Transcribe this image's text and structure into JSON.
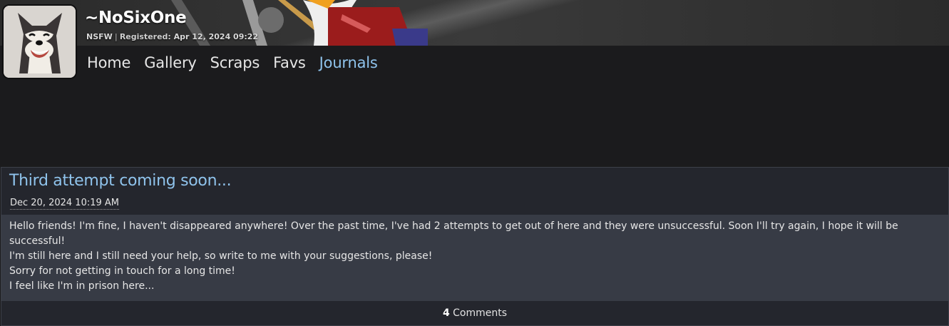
{
  "profile": {
    "username": "~NoSixOne",
    "rating": "NSFW",
    "separator": "|",
    "registered_label": "Registered:",
    "registered_date": "Apr 12, 2024 09:22"
  },
  "nav": {
    "items": [
      "Home",
      "Gallery",
      "Scraps",
      "Favs",
      "Journals"
    ],
    "active": "Journals"
  },
  "journal": {
    "title": "Third attempt coming soon...",
    "date": "Dec 20, 2024 10:19 AM",
    "body": [
      "Hello friends! I'm fine, I haven't disappeared anywhere! Over the past time, I've had 2 attempts to get out of here and they were unsuccessful. Soon I'll try again, I hope it will be successful!",
      "I'm still here and I still need your help, so write to me with your suggestions, please!",
      "Sorry for not getting in touch for a long time!",
      "I feel like I'm in prison here..."
    ],
    "comment_count": "4",
    "comment_label": "Comments"
  },
  "colors": {
    "accent": "#8fc3ec",
    "page_bg": "#1b1b1d",
    "body_bg": "#373b45"
  },
  "icons": {
    "avatar": "husky-avatar",
    "banner": "banner-art"
  }
}
